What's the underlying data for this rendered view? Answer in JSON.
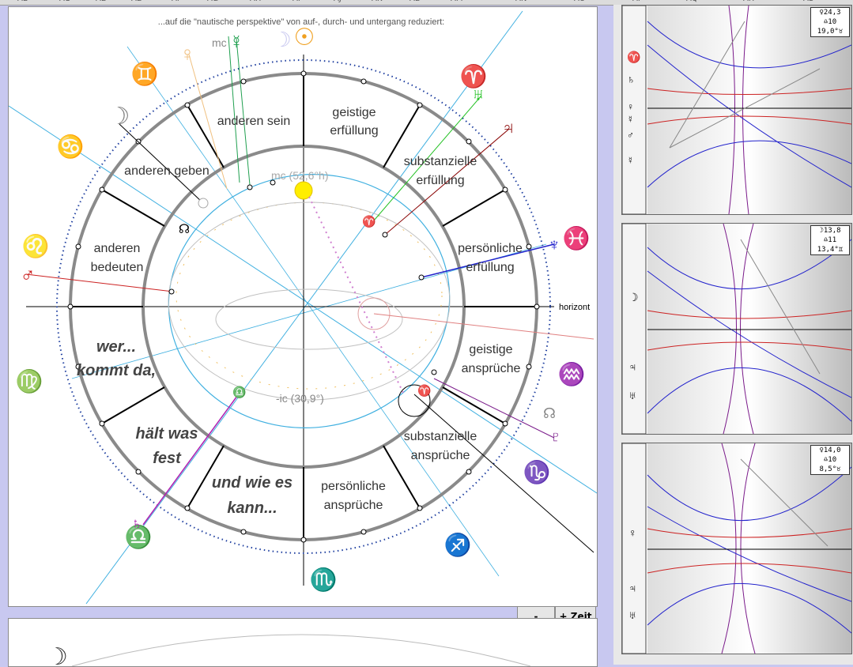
{
  "column_headers": [
    "AB",
    "AC",
    "AD",
    "AE",
    "AF",
    "AG",
    "AH",
    "AI",
    "AJ",
    "AK",
    "AL",
    "AM",
    "AN",
    "AO",
    "AP",
    "AQ",
    "AR",
    "AS"
  ],
  "chart": {
    "caption": "...auf die \"nautische perspektive\" von auf-, durch- und untergang reduziert:",
    "mc_label": "mc",
    "mc_value": "mc (52,6°h)",
    "ic_value": "-ic (30,9°)",
    "horizon_label": "horizont",
    "houses": [
      {
        "id": "h1",
        "line1": "anderen sein",
        "line2": ""
      },
      {
        "id": "h2",
        "line1": "geistige",
        "line2": "erfüllung"
      },
      {
        "id": "h3",
        "line1": "substanzielle",
        "line2": "erfüllung"
      },
      {
        "id": "h4",
        "line1": "persönliche",
        "line2": "erfüllung"
      },
      {
        "id": "h5",
        "line1": "geistige",
        "line2": "ansprüche"
      },
      {
        "id": "h6",
        "line1": "substanzielle",
        "line2": "ansprüche"
      },
      {
        "id": "h7",
        "line1": "persönliche",
        "line2": "ansprüche"
      },
      {
        "id": "h8",
        "line1": "anderen geben",
        "line2": ""
      },
      {
        "id": "h9",
        "line1": "anderen",
        "line2": "bedeuten"
      }
    ],
    "quadrants": [
      {
        "line1": "wer...",
        "line2": "kommt da,"
      },
      {
        "line1": "hält was",
        "line2": "fest"
      },
      {
        "line1": "und wie es",
        "line2": "kann..."
      }
    ],
    "zodiac_glyphs": {
      "gemini": "♊",
      "cancer": "♋",
      "leo": "♌",
      "virgo": "♍",
      "libra": "♎",
      "scorpio": "♏",
      "sagittarius": "♐",
      "capricorn": "♑",
      "aquarius": "♒",
      "pisces": "♓",
      "aries": "♈"
    },
    "planet_glyphs": {
      "sun": "☉",
      "moon": "☽",
      "mercury": "☿",
      "venus": "♀",
      "mars": "♂",
      "jupiter": "♃",
      "saturn": "♄",
      "uranus": "♅",
      "neptune": "♆",
      "node": "☊",
      "pluto": "♇"
    }
  },
  "panels": [
    {
      "id": "p1",
      "info": [
        "♀24,3",
        "♎10",
        "19,0°♉"
      ],
      "left_glyphs": [
        "♈",
        "♄",
        "♀",
        "☿",
        "♂",
        "☿"
      ]
    },
    {
      "id": "p2",
      "info": [
        "☽13,8",
        "♎11",
        "13,4°♊"
      ],
      "left_glyphs": [
        "☽",
        "♃",
        "♅"
      ]
    },
    {
      "id": "p3",
      "info": [
        "♀14,0",
        "♎10",
        "8,5°♉"
      ],
      "left_glyphs": [
        "♀",
        "♃",
        "♅"
      ]
    }
  ],
  "buttons": {
    "minus": "-",
    "plus": "+ Zeit"
  },
  "colors": {
    "sun": "#f0a020",
    "venus": "#f0c080",
    "mercury": "#20a050",
    "moon": "#7a7a7a",
    "mars": "#cc2222",
    "jupiter": "#880000",
    "uranus": "#2222cc",
    "saturn": "#b020b0",
    "pluto": "#7a1a8a",
    "sign": "#9090e0",
    "cyan": "#40b0e0",
    "ring": "#8a8a8a"
  }
}
